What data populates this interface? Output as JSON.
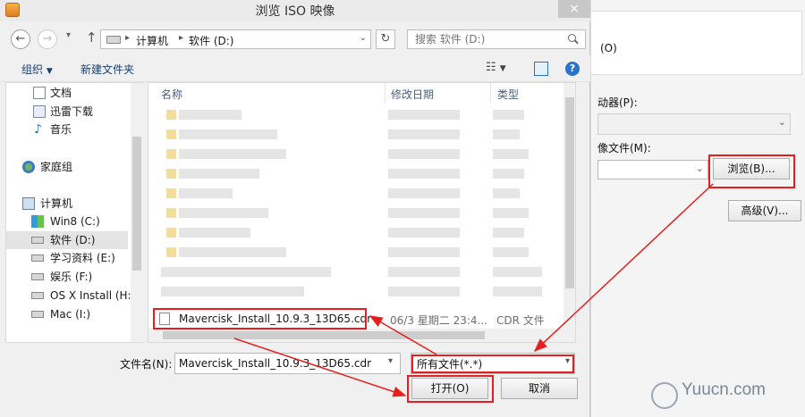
{
  "window": {
    "title": "浏览 ISO 映像",
    "close_glyph": "×"
  },
  "nav": {
    "back_glyph": "←",
    "forward_glyph": "→",
    "up_glyph": "↑",
    "breadcrumb": [
      "计算机",
      "软件 (D:)"
    ],
    "refresh_glyph": "↻",
    "search_placeholder": "搜索 软件 (D:)"
  },
  "toolbar": {
    "organize_label": "组织",
    "new_folder_label": "新建文件夹"
  },
  "sidebar": {
    "items": [
      {
        "label": "文档",
        "icon": "document-icon"
      },
      {
        "label": "迅雷下载",
        "icon": "download-icon"
      },
      {
        "label": "音乐",
        "icon": "music-icon"
      },
      {
        "label": "家庭组",
        "icon": "homegroup-icon"
      },
      {
        "label": "计算机",
        "icon": "computer-icon"
      },
      {
        "label": "Win8 (C:)",
        "icon": "drive-icon"
      },
      {
        "label": "软件 (D:)",
        "icon": "drive-icon",
        "selected": true
      },
      {
        "label": "学习资料 (E:)",
        "icon": "drive-icon"
      },
      {
        "label": "娱乐 (F:)",
        "icon": "drive-icon"
      },
      {
        "label": "OS X Install (H:)",
        "icon": "drive-icon"
      },
      {
        "label": "Mac (I:)",
        "icon": "drive-icon"
      }
    ]
  },
  "filelist": {
    "columns": [
      "名称",
      "修改日期",
      "类型"
    ],
    "highlighted_file": {
      "name": "Mavercisk_Install_10.9.3_13D65.cdr",
      "date": "06/3 星期二 23:4...",
      "type": "CDR 文件"
    }
  },
  "footer": {
    "filename_label": "文件名(N):",
    "filename_value": "Mavercisk_Install_10.9.3_13D65.cdr",
    "filter_value": "所有文件(*.*)",
    "open_label": "打开(O)",
    "cancel_label": "取消"
  },
  "background_dialog": {
    "option_text": "(O)",
    "drive_label": "动器(P):",
    "image_file_label": "像文件(M):",
    "browse_label": "浏览(B)...",
    "advanced_label": "高级(V)..."
  },
  "watermark": {
    "text": "Yuucn.com"
  },
  "colors": {
    "annotation": "#e61e1e",
    "accent": "#2b72c9"
  }
}
